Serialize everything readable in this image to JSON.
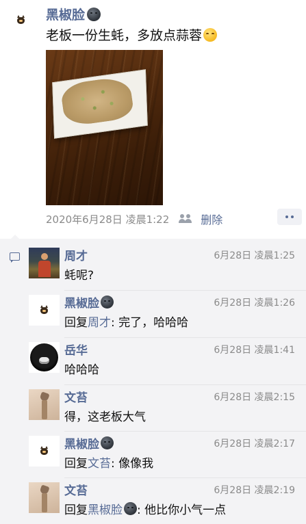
{
  "post": {
    "author": "黑椒脸",
    "author_emoji": "moon-face-icon",
    "text": "老板一份生蚝，多放点蒜蓉",
    "text_emoji": "smiley-icon",
    "timestamp": "2020年6月28日 凌晨1:22",
    "delete_label": "删除"
  },
  "comments": [
    {
      "name": "周才",
      "name_emoji": false,
      "time": "6月28日 凌晨1:25",
      "text": "蚝呢?",
      "reply_prefix": "",
      "reply_to": "",
      "reply_to_emoji": false,
      "avatar": "zhou"
    },
    {
      "name": "黑椒脸",
      "name_emoji": true,
      "time": "6月28日 凌晨1:26",
      "text": ": 完了，哈哈哈",
      "reply_prefix": "回复",
      "reply_to": "周才",
      "reply_to_emoji": false,
      "avatar": "cat"
    },
    {
      "name": "岳华",
      "name_emoji": false,
      "time": "6月28日 凌晨1:41",
      "text": "哈哈哈",
      "reply_prefix": "",
      "reply_to": "",
      "reply_to_emoji": false,
      "avatar": "yue"
    },
    {
      "name": "文苔",
      "name_emoji": false,
      "time": "6月28日 凌晨2:15",
      "text": "得，这老板大气",
      "reply_prefix": "",
      "reply_to": "",
      "reply_to_emoji": false,
      "avatar": "wen"
    },
    {
      "name": "黑椒脸",
      "name_emoji": true,
      "time": "6月28日 凌晨2:17",
      "text": ": 像像我",
      "reply_prefix": "回复",
      "reply_to": "文苔",
      "reply_to_emoji": false,
      "avatar": "cat"
    },
    {
      "name": "文苔",
      "name_emoji": false,
      "time": "6月28日 凌晨2:19",
      "text": ": 他比你小气一点",
      "reply_prefix": "回复",
      "reply_to": "黑椒脸",
      "reply_to_emoji": true,
      "avatar": "wen"
    }
  ],
  "colors": {
    "link": "#576b95",
    "meta": "#8a8a8a",
    "comment_bg": "#f3f3f5"
  }
}
